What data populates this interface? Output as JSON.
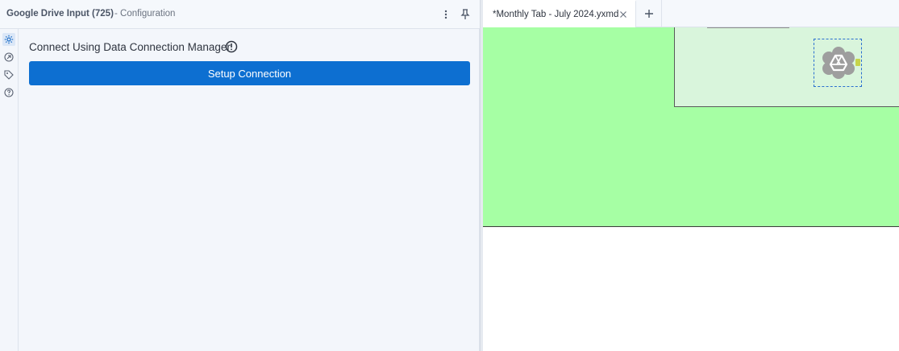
{
  "config_panel": {
    "title": "Google Drive Input (725)",
    "subtitle": "- Configuration",
    "connect_label": "Connect Using Data Connection Manager",
    "setup_button_label": "Setup Connection",
    "rail_icons": [
      "settings-gear-icon",
      "output-arrow-icon",
      "tag-icon",
      "help-icon"
    ]
  },
  "tabs": [
    {
      "label": "*Monthly Tab - July 2024.yxmd",
      "active": true
    }
  ],
  "canvas": {
    "container_color": "#a6ffa4",
    "inner_container_color": "#d9f5dc",
    "tool": {
      "name": "Google Drive Input",
      "icon": "google-drive-icon"
    }
  },
  "colors": {
    "accent": "#0d6fd1",
    "panel_bg": "#f3f6fb"
  }
}
